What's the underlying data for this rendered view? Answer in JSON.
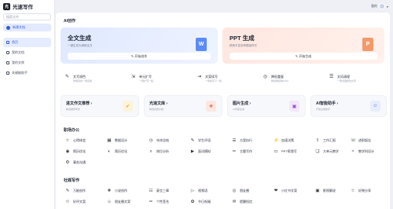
{
  "app": {
    "title": "光速写作",
    "logo": "光"
  },
  "sidebar": {
    "search_placeholder": "搜索文件",
    "new_chat": "新建文档",
    "items": [
      {
        "label": "首页",
        "icon": "home-icon",
        "active": true
      },
      {
        "label": "我的文档",
        "icon": "doc-icon"
      },
      {
        "label": "我的文库",
        "icon": "library-icon"
      },
      {
        "label": "关键能助手",
        "icon": "assistant-icon"
      }
    ]
  },
  "user": {
    "name": "我的",
    "caret": "▾"
  },
  "ai_section": {
    "title": "AI创作",
    "cards": [
      {
        "title": "全文生成",
        "subtitle": "一键生成大纲和全文",
        "button": "✎ 开始创作",
        "icon_letter": "W"
      },
      {
        "title": "PPT 生成",
        "subtitle": "精美丰富多种模板样式",
        "button": "✎ 开始生成",
        "icon_letter": "P"
      }
    ]
  },
  "tools": [
    {
      "title": "文写润色",
      "sub": "智能润色一键完成",
      "icon": "✎"
    },
    {
      "title": "单元扩写",
      "sub": "一键扩写一段",
      "icon": "⇲"
    },
    {
      "title": "文案续写",
      "sub": "一键续写下一段",
      "icon": "⇥"
    },
    {
      "title": "降低重复",
      "sub": "降低重复降AIGC",
      "icon": "◎"
    },
    {
      "title": "文风清理",
      "sub": "一键清理修改文风",
      "icon": "☰"
    }
  ],
  "mid_cards": [
    {
      "title": "进文作文推荐 ›",
      "sub": "精选推荐写作",
      "icon": "✔",
      "bg": "#fbf3dc",
      "fg": "#e0a020"
    },
    {
      "title": "光速文库 ›",
      "sub": "精选优质文档",
      "icon": "✚",
      "bg": "#fde7e1",
      "fg": "#e0704a"
    },
    {
      "title": "图片生成 ›",
      "sub": "AI智能生成",
      "icon": "▣",
      "bg": "#f3e7fb",
      "fg": "#9a52d0"
    },
    {
      "title": "AI智能助手 ›",
      "sub": "开发全能助手",
      "icon": "☺",
      "bg": "#e7edfb",
      "fg": "#4b6fe0"
    }
  ],
  "office_section": {
    "title": "职场办公",
    "items": [
      {
        "label": "心得体会",
        "icon": "☆"
      },
      {
        "label": "数据设计",
        "icon": "▦"
      },
      {
        "label": "年终总结",
        "icon": "◷"
      },
      {
        "label": "学生评语",
        "icon": "✎"
      },
      {
        "label": "方案执行",
        "icon": "☰"
      },
      {
        "label": "加速决策",
        "icon": "⚡"
      },
      {
        "label": "工作汇报",
        "icon": "⇪"
      },
      {
        "label": "述职报告",
        "icon": "☏"
      },
      {
        "label": "简历优化",
        "icon": "◉"
      },
      {
        "label": "简历优化",
        "icon": "◐"
      },
      {
        "label": "岗位分析",
        "icon": "⌕"
      },
      {
        "label": "面试模拟",
        "icon": "▶"
      },
      {
        "label": "主题写作",
        "icon": "✑"
      },
      {
        "label": "PPT帮我写",
        "icon": "▭"
      },
      {
        "label": "大单元教学",
        "icon": "❑"
      },
      {
        "label": "教学科设计",
        "icon": "✧"
      },
      {
        "label": "事务沟通",
        "icon": "⚙"
      }
    ]
  },
  "social_section": {
    "title": "社媒写作",
    "items": [
      {
        "label": "万能创作",
        "icon": "✎"
      },
      {
        "label": "小说创作",
        "icon": "❖"
      },
      {
        "label": "豪言三章",
        "icon": "☷"
      },
      {
        "label": "视频语",
        "icon": "▷"
      },
      {
        "label": "朋友圈",
        "icon": "◎"
      },
      {
        "label": "小红书文案",
        "icon": "❤"
      },
      {
        "label": "影视解说",
        "icon": "▣"
      },
      {
        "label": "好物分享",
        "icon": "☆"
      },
      {
        "label": "好评文案",
        "icon": "✩"
      },
      {
        "label": "朋友圈文案",
        "icon": "☺"
      },
      {
        "label": "个性签名",
        "icon": "✑"
      },
      {
        "label": "节日祝福",
        "icon": "✿"
      },
      {
        "label": "提醒短信",
        "icon": "✉"
      }
    ]
  }
}
